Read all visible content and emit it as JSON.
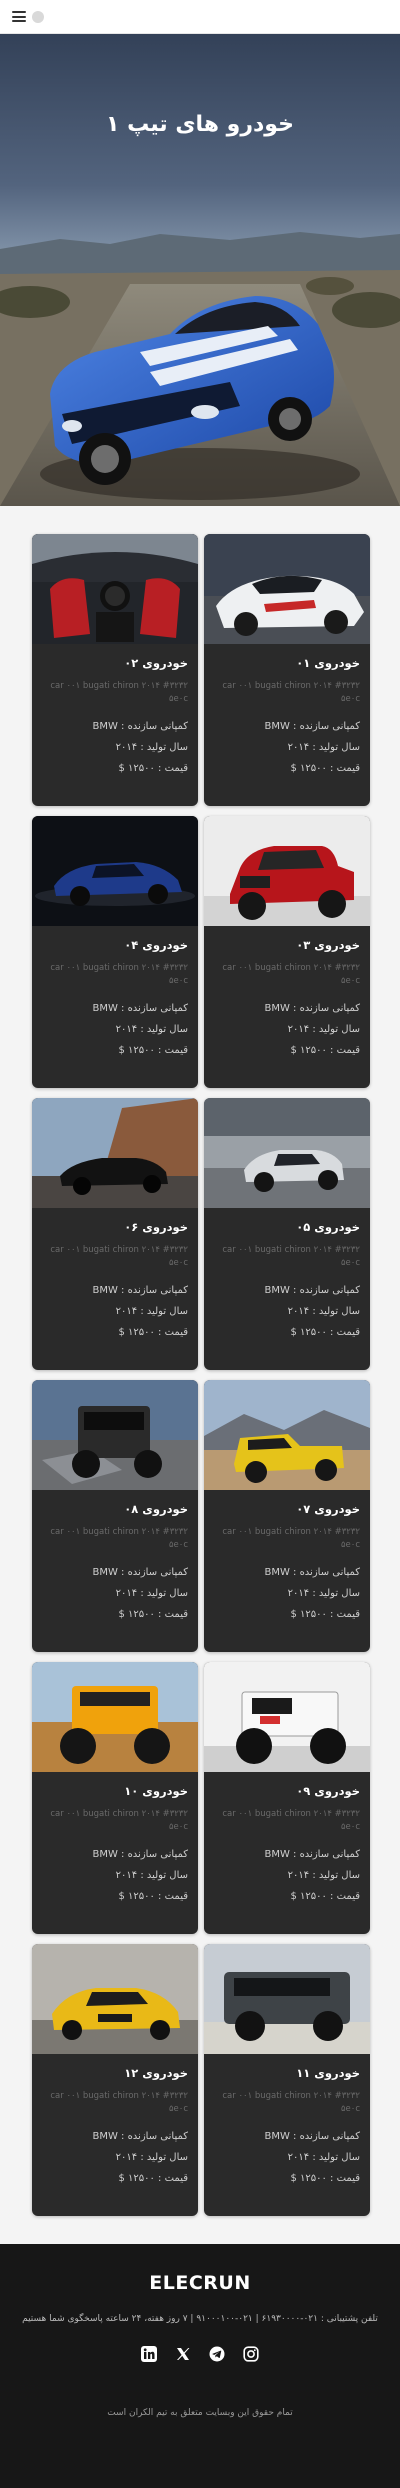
{
  "hero": {
    "title": "خودرو های تیپ ۱"
  },
  "colors": {
    "card_bg": "#2a2a2a",
    "footer_bg": "#171717",
    "page_bg": "#f4f4f4"
  },
  "cards": [
    {
      "title": "خودروی ۰۱",
      "desc": "car ۰۰۱ bugati chiron ۲۰۱۴ #۳۲۳۲ ۵e۰c",
      "company": "کمپانی سازنده : BMW",
      "year": "سال تولید : ۲۰۱۴",
      "price": "قیمت : ۱۲۵۰۰ $"
    },
    {
      "title": "خودروی ۰۲",
      "desc": "car ۰۰۱ bugati chiron ۲۰۱۴ #۳۲۳۲ ۵e۰c",
      "company": "کمپانی سازنده : BMW",
      "year": "سال تولید : ۲۰۱۴",
      "price": "قیمت : ۱۲۵۰۰ $"
    },
    {
      "title": "خودروی ۰۳",
      "desc": "car ۰۰۱ bugati chiron ۲۰۱۴ #۳۲۳۲ ۵e۰c",
      "company": "کمپانی سازنده : BMW",
      "year": "سال تولید : ۲۰۱۴",
      "price": "قیمت : ۱۲۵۰۰ $"
    },
    {
      "title": "خودروی ۰۴",
      "desc": "car ۰۰۱ bugati chiron ۲۰۱۴ #۳۲۳۲ ۵e۰c",
      "company": "کمپانی سازنده : BMW",
      "year": "سال تولید : ۲۰۱۴",
      "price": "قیمت : ۱۲۵۰۰ $"
    },
    {
      "title": "خودروی ۰۵",
      "desc": "car ۰۰۱ bugati chiron ۲۰۱۴ #۳۲۳۲ ۵e۰c",
      "company": "کمپانی سازنده : BMW",
      "year": "سال تولید : ۲۰۱۴",
      "price": "قیمت : ۱۲۵۰۰ $"
    },
    {
      "title": "خودروی ۰۶",
      "desc": "car ۰۰۱ bugati chiron ۲۰۱۴ #۳۲۳۲ ۵e۰c",
      "company": "کمپانی سازنده : BMW",
      "year": "سال تولید : ۲۰۱۴",
      "price": "قیمت : ۱۲۵۰۰ $"
    },
    {
      "title": "خودروی ۰۷",
      "desc": "car ۰۰۱ bugati chiron ۲۰۱۴ #۳۲۳۲ ۵e۰c",
      "company": "کمپانی سازنده : BMW",
      "year": "سال تولید : ۲۰۱۴",
      "price": "قیمت : ۱۲۵۰۰ $"
    },
    {
      "title": "خودروی ۰۸",
      "desc": "car ۰۰۱ bugati chiron ۲۰۱۴ #۳۲۳۲ ۵e۰c",
      "company": "کمپانی سازنده : BMW",
      "year": "سال تولید : ۲۰۱۴",
      "price": "قیمت : ۱۲۵۰۰ $"
    },
    {
      "title": "خودروی ۰۹",
      "desc": "car ۰۰۱ bugati chiron ۲۰۱۴ #۳۲۳۲ ۵e۰c",
      "company": "کمپانی سازنده : BMW",
      "year": "سال تولید : ۲۰۱۴",
      "price": "قیمت : ۱۲۵۰۰ $"
    },
    {
      "title": "خودروی ۱۰",
      "desc": "car ۰۰۱ bugati chiron ۲۰۱۴ #۳۲۳۲ ۵e۰c",
      "company": "کمپانی سازنده : BMW",
      "year": "سال تولید : ۲۰۱۴",
      "price": "قیمت : ۱۲۵۰۰ $"
    },
    {
      "title": "خودروی ۱۱",
      "desc": "car ۰۰۱ bugati chiron ۲۰۱۴ #۳۲۳۲ ۵e۰c",
      "company": "کمپانی سازنده : BMW",
      "year": "سال تولید : ۲۰۱۴",
      "price": "قیمت : ۱۲۵۰۰ $"
    },
    {
      "title": "خودروی ۱۲",
      "desc": "car ۰۰۱ bugati chiron ۲۰۱۴ #۳۲۳۲ ۵e۰c",
      "company": "کمپانی سازنده : BMW",
      "year": "سال تولید : ۲۰۱۴",
      "price": "قیمت : ۱۲۵۰۰ $"
    }
  ],
  "footer": {
    "brand": "ELECRUN",
    "contact": "تلفن پشتیبانی : ۰۲۱-۶۱۹۳۰۰۰۰ | ۰۲۱-۹۱۰۰۰۱۰۰ | ۷ روز هفته، ۲۴ ساعته پاسخگوی شما هستیم",
    "socials": [
      "linkedin-icon",
      "x-icon",
      "telegram-icon",
      "instagram-icon"
    ],
    "copyright": "تمام حقوق این وبسایت متعلق به تیم الکران است"
  }
}
